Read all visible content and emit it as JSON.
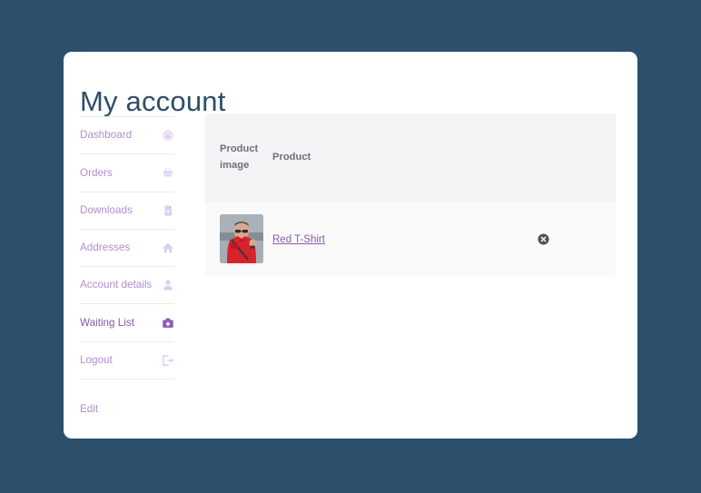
{
  "theme": {
    "page_background": "#2c4f6b",
    "card_background": "#ffffff",
    "accent_purple": "#8a5aa8",
    "muted_purple": "#b08ed0",
    "table_header_background": "#f4f4f6",
    "table_row_background": "#fafafb",
    "title_color": "#2f4d68"
  },
  "account": {
    "title": "My account",
    "nav": {
      "items": [
        {
          "label": "Dashboard",
          "icon": "dashboard-gauge-icon",
          "active": false
        },
        {
          "label": "Orders",
          "icon": "shopping-basket-icon",
          "active": false
        },
        {
          "label": "Downloads",
          "icon": "file-download-icon",
          "active": false
        },
        {
          "label": "Addresses",
          "icon": "home-icon",
          "active": false
        },
        {
          "label": "Account details",
          "icon": "user-icon",
          "active": false
        },
        {
          "label": "Waiting List",
          "icon": "medical-bag-icon",
          "active": true
        },
        {
          "label": "Logout",
          "icon": "logout-arrow-icon",
          "active": false
        }
      ],
      "extra": {
        "label": "Edit"
      }
    }
  },
  "waiting_list": {
    "columns": [
      {
        "key": "image",
        "label": "Product image"
      },
      {
        "key": "name",
        "label": "Product"
      },
      {
        "key": "remove",
        "label": ""
      }
    ],
    "rows": [
      {
        "image_alt": "Red T-Shirt product photo",
        "name": "Red T-Shirt",
        "remove_icon": "remove-circle-x-icon",
        "remove_label": ""
      }
    ]
  }
}
